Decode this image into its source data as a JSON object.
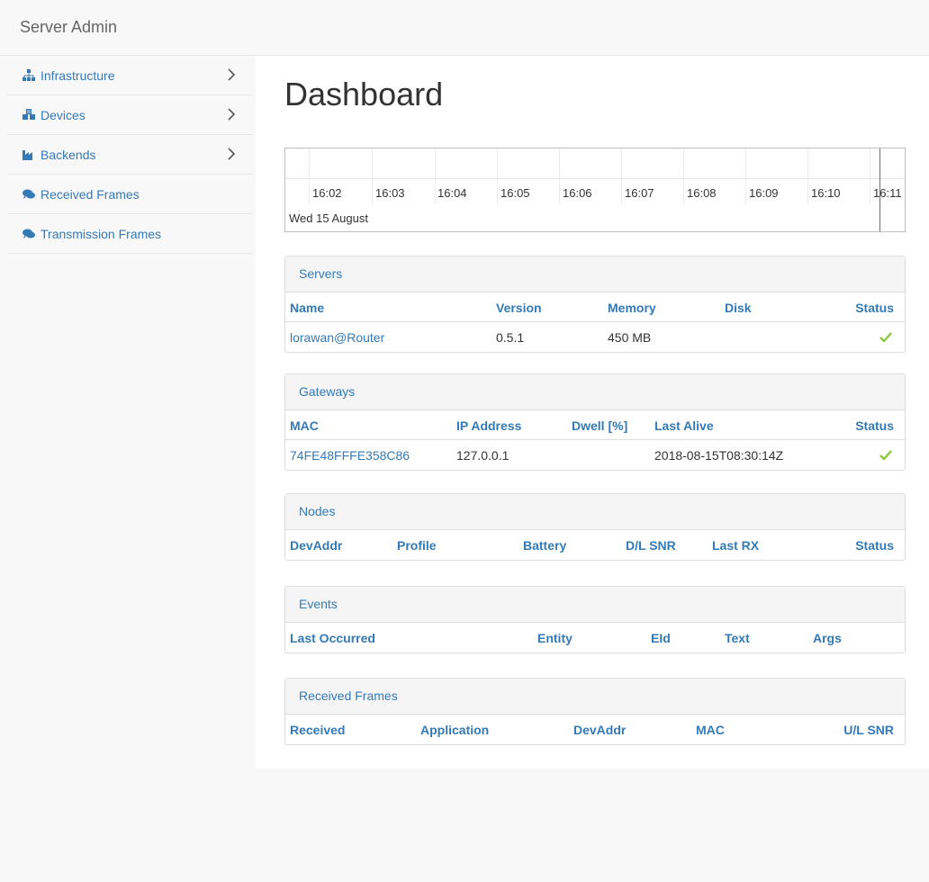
{
  "app": {
    "title": "Server Admin"
  },
  "sidebar": {
    "items": [
      {
        "label": "Infrastructure",
        "icon": "sitemap-icon",
        "has_submenu": true
      },
      {
        "label": "Devices",
        "icon": "cubes-icon",
        "has_submenu": true
      },
      {
        "label": "Backends",
        "icon": "industry-icon",
        "has_submenu": true
      },
      {
        "label": "Received Frames",
        "icon": "comments-icon",
        "has_submenu": false
      },
      {
        "label": "Transmission Frames",
        "icon": "comments-icon",
        "has_submenu": false
      }
    ]
  },
  "main": {
    "title": "Dashboard"
  },
  "timeline": {
    "ticks": [
      "16:02",
      "16:03",
      "16:04",
      "16:05",
      "16:06",
      "16:07",
      "16:08",
      "16:09",
      "16:10",
      "16:11"
    ],
    "date_label": "Wed 15 August",
    "now_color": "#e63b2e"
  },
  "servers": {
    "title": "Servers",
    "columns": [
      "Name",
      "Version",
      "Memory",
      "Disk",
      "Status"
    ],
    "rows": [
      {
        "name": "lorawan@Router",
        "version": "0.5.1",
        "memory": "450 MB",
        "disk": "",
        "status": "ok"
      }
    ]
  },
  "gateways": {
    "title": "Gateways",
    "columns": [
      "MAC",
      "IP Address",
      "Dwell [%]",
      "Last Alive",
      "Status"
    ],
    "rows": [
      {
        "mac": "74FE48FFFE358C86",
        "ip": "127.0.0.1",
        "dwell": "",
        "last_alive": "2018-08-15T08:30:14Z",
        "status": "ok"
      }
    ]
  },
  "nodes": {
    "title": "Nodes",
    "columns": [
      "DevAddr",
      "Profile",
      "Battery",
      "D/L SNR",
      "Last RX",
      "Status"
    ]
  },
  "events": {
    "title": "Events",
    "columns": [
      "Last Occurred",
      "Entity",
      "EId",
      "Text",
      "Args"
    ]
  },
  "received_frames": {
    "title": "Received Frames",
    "columns": [
      "Received",
      "Application",
      "DevAddr",
      "MAC",
      "U/L SNR"
    ]
  },
  "colors": {
    "accent": "#337ab7",
    "ok": "#8cc63f"
  }
}
